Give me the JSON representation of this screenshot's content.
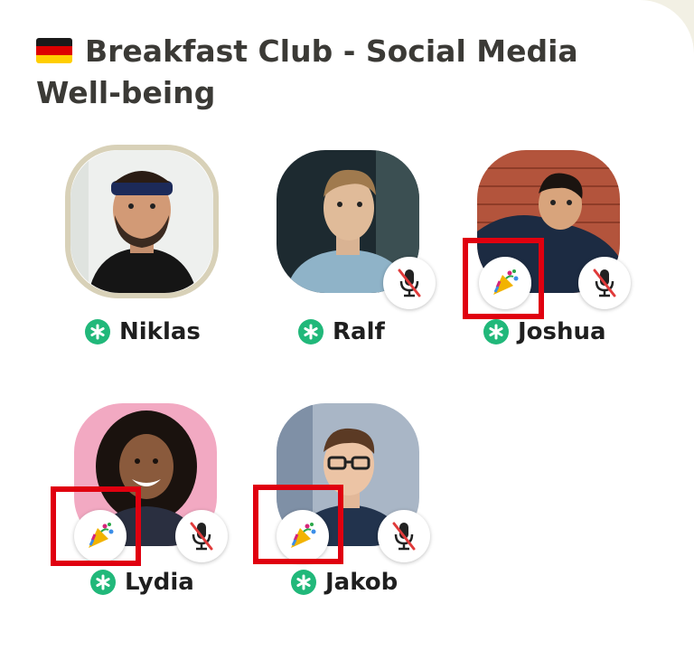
{
  "room": {
    "title": "Breakfast Club - Social Media Well-being",
    "flag_icon": "germany-flag-icon"
  },
  "colors": {
    "background": "#ffffff",
    "moderator_badge": "#21b87a",
    "highlight_box": "#e0000f",
    "ring": "#d8d1b8"
  },
  "speakers": [
    {
      "name": "Niklas",
      "moderator": true,
      "speaking": true,
      "muted": false,
      "reaction": ""
    },
    {
      "name": "Ralf",
      "moderator": true,
      "speaking": false,
      "muted": true,
      "reaction": ""
    },
    {
      "name": "Joshua",
      "moderator": true,
      "speaking": false,
      "muted": true,
      "reaction": "party-popper-icon"
    },
    {
      "name": "Lydia",
      "moderator": true,
      "speaking": false,
      "muted": true,
      "reaction": "party-popper-icon"
    },
    {
      "name": "Jakob",
      "moderator": true,
      "speaking": false,
      "muted": true,
      "reaction": "party-popper-icon"
    }
  ]
}
